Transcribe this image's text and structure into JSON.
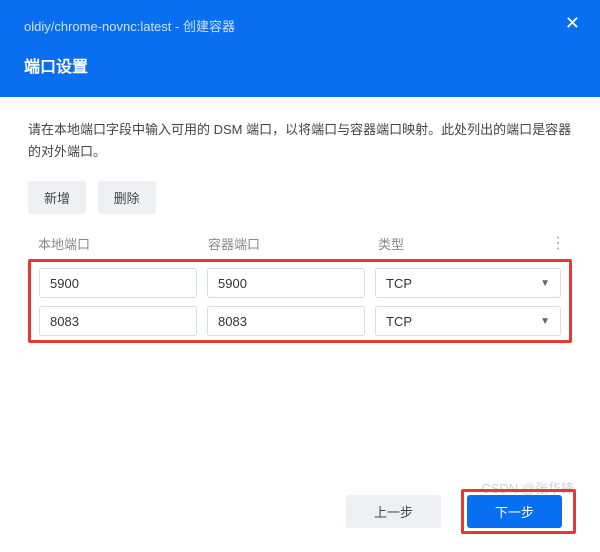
{
  "header": {
    "title": "oldiy/chrome-novnc:latest - 创建容器",
    "subtitle": "端口设置",
    "close": "✕"
  },
  "desc": "请在本地端口字段中输入可用的 DSM 端口，以将端口与容器端口映射。此处列出的端口是容器的对外端口。",
  "actions": {
    "add": "新增",
    "delete": "删除"
  },
  "columns": {
    "local": "本地端口",
    "container": "容器端口",
    "type": "类型",
    "menu": "⋮"
  },
  "rows": [
    {
      "local": "5900",
      "container": "5900",
      "type": "TCP"
    },
    {
      "local": "8083",
      "container": "8083",
      "type": "TCP"
    }
  ],
  "footer": {
    "prev": "上一步",
    "next": "下一步"
  },
  "watermark": "CSDN @张华锋"
}
